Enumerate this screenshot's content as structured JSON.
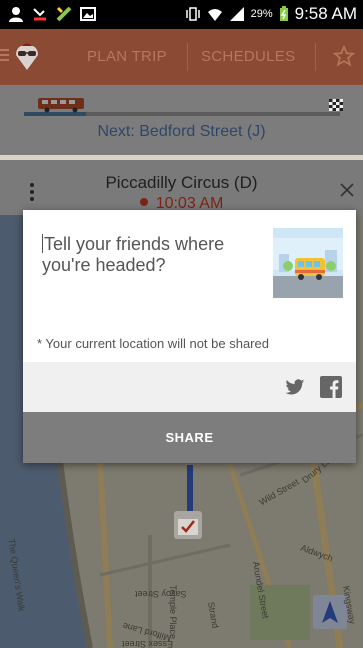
{
  "status_bar": {
    "battery_percent": "29%",
    "time": "9:58 AM",
    "icons": [
      "profile-icon",
      "missed-call-icon",
      "app-icon",
      "image-icon",
      "vibrate-icon",
      "wifi-icon",
      "signal-icon",
      "battery-icon"
    ]
  },
  "app_bar": {
    "tabs": [
      {
        "label": "PLAN TRIP"
      },
      {
        "label": "SCHEDULES"
      }
    ],
    "icons": [
      "menu-icon",
      "logo-icon",
      "star-icon"
    ],
    "color": "#e8683d"
  },
  "trip": {
    "next_stop": "Next: Bedford Street (J)"
  },
  "stop_card": {
    "name": "Piccadilly Circus (D)",
    "time": "10:03 AM"
  },
  "map": {
    "street_labels": [
      "The Queen's Walk",
      "Savoy Street",
      "Temple Place",
      "Milford Lane",
      "Essex Street",
      "Strand",
      "Arundel Street",
      "Drury Lane",
      "Wild Street",
      "Aldwych",
      "Kingsway"
    ]
  },
  "dialog": {
    "prompt": "Tell your friends where you're headed?",
    "note": "* Your current location will not be shared",
    "share_label": "SHARE",
    "icons": [
      "twitter-icon",
      "facebook-icon"
    ]
  }
}
